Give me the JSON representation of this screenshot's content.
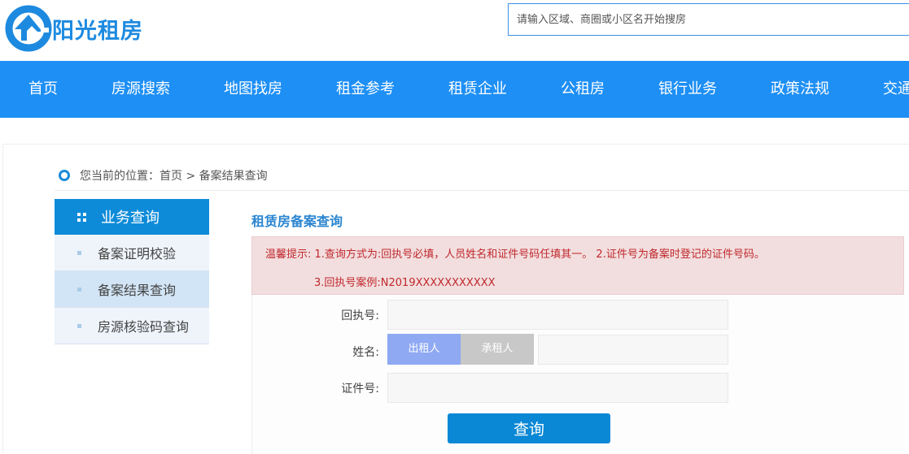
{
  "header": {
    "logo_text": "阳光租房",
    "search_placeholder": "请输入区域、商圈或小区名开始搜房"
  },
  "nav": [
    "首页",
    "房源搜索",
    "地图找房",
    "租金参考",
    "租赁企业",
    "公租房",
    "银行业务",
    "政策法规",
    "交通"
  ],
  "breadcrumb": {
    "prefix": "您当前的位置：",
    "home": "首页",
    "sep": ">",
    "current": "备案结果查询"
  },
  "sidebar": {
    "title": "业务查询",
    "items": [
      {
        "label": "备案证明校验"
      },
      {
        "label": "备案结果查询",
        "active": true
      },
      {
        "label": "房源核验码查询"
      }
    ]
  },
  "main": {
    "title": "租赁房备案查询",
    "alert": {
      "line1": "温馨提示: 1.查询方式为:回执号必填，人员姓名和证件号码任填其一。 2.证件号为备案时登记的证件号码。",
      "line2": "3.回执号案例:N2019XXXXXXXXXXX"
    },
    "form": {
      "receipt_label": "回执号:",
      "name_label": "姓名:",
      "lessor": "出租人",
      "lessee": "承租人",
      "id_label": "证件号:",
      "receipt_value": "",
      "name_value": "",
      "id_value": "",
      "submit": "查询"
    }
  },
  "colors": {
    "brand": "#1e8ff5",
    "sidebar_head": "#0d8bd9",
    "lessor_active": "#8fa9f3",
    "lessee_inactive": "#c8c8c8",
    "alert_text": "#c0282d"
  }
}
